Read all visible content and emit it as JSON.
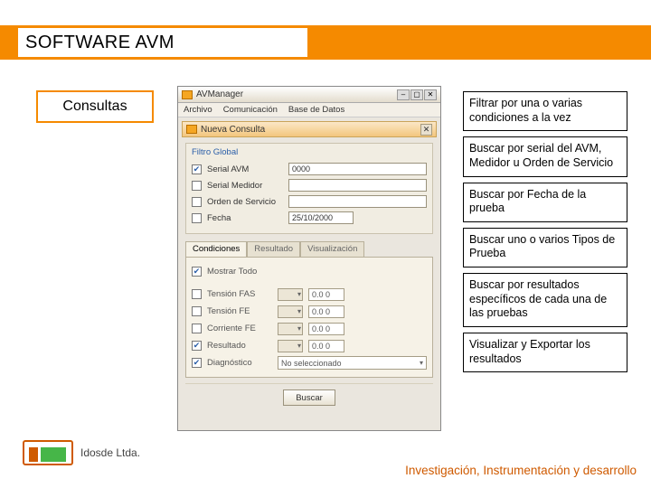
{
  "header": {
    "title": "SOFTWARE AVM"
  },
  "consultas_label": "Consultas",
  "notes": [
    "Filtrar por una o varias condiciones a la vez",
    "Buscar por serial del AVM, Medidor u Orden de Servicio",
    "Buscar por Fecha de la prueba",
    "Buscar uno o varios Tipos de Prueba",
    "Buscar por resultados específicos de cada una de las pruebas",
    "Visualizar y Exportar los resultados"
  ],
  "window": {
    "title": "AVManager",
    "menubar": [
      "Archivo",
      "Comunicación",
      "Base de Datos"
    ],
    "panel_title": "Nueva Consulta",
    "filter_group_title": "Filtro Global",
    "filters": [
      {
        "label": "Serial AVM",
        "checked": true,
        "value": "0000"
      },
      {
        "label": "Serial Medidor",
        "checked": false,
        "value": ""
      },
      {
        "label": "Orden de Servicio",
        "checked": false,
        "value": ""
      },
      {
        "label": "Fecha",
        "checked": false,
        "value": "25/10/2000"
      }
    ],
    "tabs": [
      "Condiciones",
      "Resultado",
      "Visualización"
    ],
    "active_tab": 0,
    "mostrar_todo": {
      "label": "Mostrar Todo",
      "checked": true
    },
    "result_rows": [
      {
        "label": "Tensión FAS",
        "checked": false,
        "num": "0.0 0"
      },
      {
        "label": "Tensión FE",
        "checked": false,
        "num": "0.0 0"
      },
      {
        "label": "Corriente FE",
        "checked": false,
        "num": "0.0 0"
      },
      {
        "label": "Resultado",
        "checked": true,
        "num": "0.0 0"
      }
    ],
    "diagnostico": {
      "label": "Diagnóstico",
      "checked": true,
      "value": "No seleccionado"
    },
    "buttons": {
      "buscar": "Buscar"
    }
  },
  "brand": {
    "name": "Idosde Ltda."
  },
  "footer": "Investigación, Instrumentación y desarrollo"
}
